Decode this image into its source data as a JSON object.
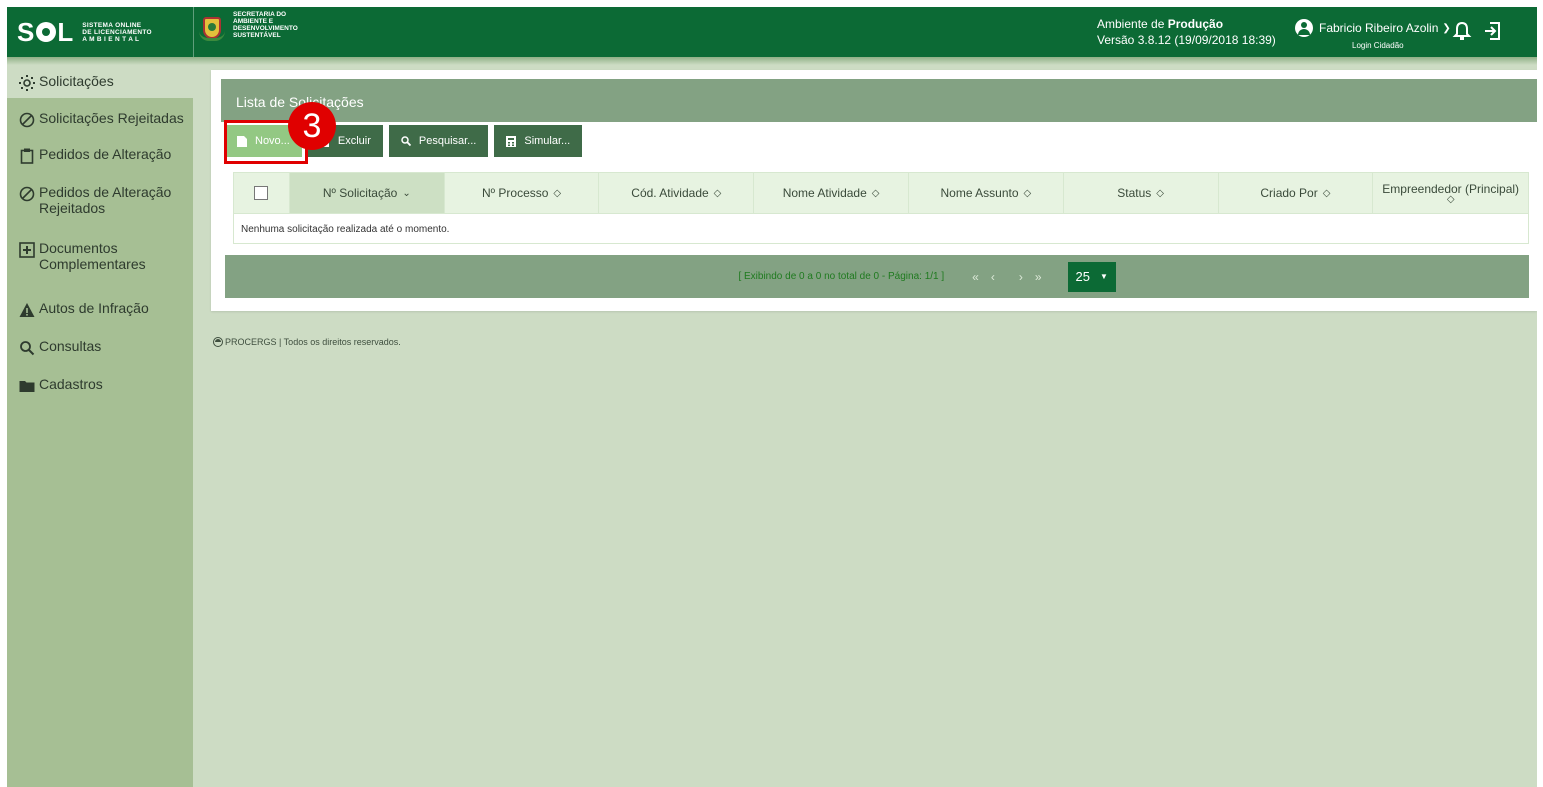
{
  "header": {
    "logo_text": "S L",
    "logo_sub": [
      "SISTEMA ONLINE",
      "DE LICENCIAMENTO",
      "A M B I E N T A L"
    ],
    "secretaria": [
      "SECRETARIA DO",
      "AMBIENTE E",
      "DESENVOLVIMENTO",
      "SUSTENTÁVEL"
    ],
    "env_prefix": "Ambiente de ",
    "env_name": "Produção",
    "version": "Versão 3.8.12 (19/09/2018 18:39)",
    "user_name": "Fabricio Ribeiro Azolin",
    "login_type": "Login Cidadão",
    "colors": {
      "header": "#0c6a35",
      "sidebar": "#a6bf94",
      "background": "#cddcc4"
    }
  },
  "sidebar": {
    "items": [
      {
        "label": "Solicitações",
        "icon": "sun-icon",
        "active": true
      },
      {
        "label": "Solicitações Rejeitadas",
        "icon": "ban-icon"
      },
      {
        "label": "Pedidos de Alteração",
        "icon": "clipboard-icon"
      },
      {
        "label": "Pedidos de Alteração Rejeitados",
        "icon": "ban-icon"
      },
      {
        "label": "Documentos Complementares",
        "icon": "plus-box-icon"
      },
      {
        "label": "Autos de Infração",
        "icon": "warning-icon"
      },
      {
        "label": "Consultas",
        "icon": "search-icon"
      },
      {
        "label": "Cadastros",
        "icon": "folder-icon"
      }
    ]
  },
  "main": {
    "title": "Lista de Solicitações",
    "toolbar": {
      "new_label": "Novo...",
      "delete_label": "Excluir",
      "search_label": "Pesquisar...",
      "simulate_label": "Simular..."
    },
    "step_number": "3",
    "table": {
      "columns": [
        "Nº Solicitação",
        "Nº Processo",
        "Cód. Atividade",
        "Nome Atividade",
        "Nome Assunto",
        "Status",
        "Criado Por",
        "Empreendedor (Principal)"
      ],
      "sorted_column": "Nº Solicitação",
      "empty_message": "Nenhuma solicitação realizada até o momento."
    },
    "pager": {
      "info": "[ Exibindo de 0 a 0 no total de 0 - Página: 1/1 ]",
      "first": "«",
      "prev": "‹",
      "next": "›",
      "last": "»",
      "page_size": "25"
    },
    "footer": "PROCERGS | Todos os direitos reservados."
  }
}
